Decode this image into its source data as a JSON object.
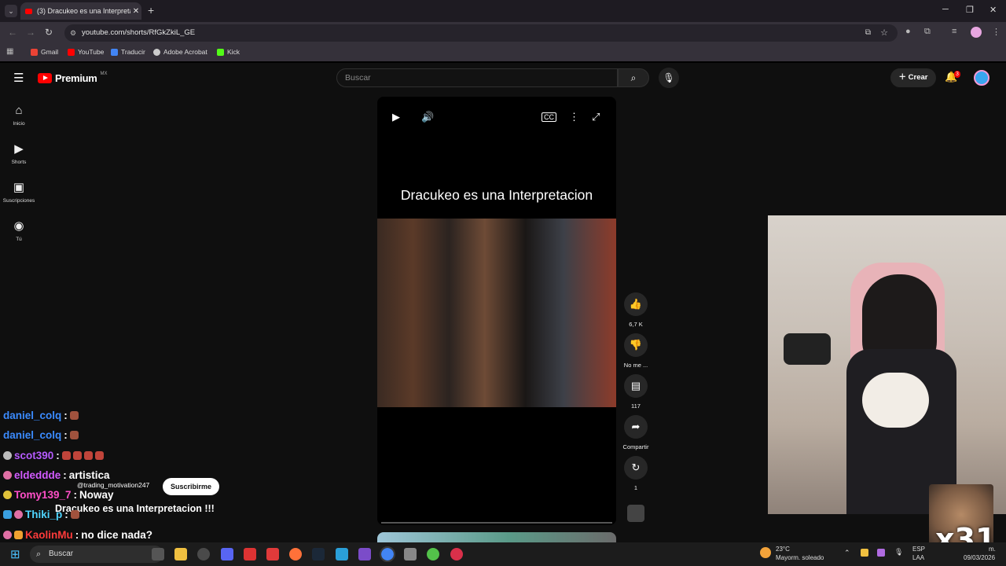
{
  "browser": {
    "tab_title": "(3) Dracukeo es una Interpretac",
    "url": "youtube.com/shorts/RfGkZkiL_GE",
    "bookmarks": [
      {
        "label": "Gmail",
        "color": "#ea4335"
      },
      {
        "label": "YouTube",
        "color": "#ff0000"
      },
      {
        "label": "Traducir",
        "color": "#4285f4"
      },
      {
        "label": "Adobe Acrobat",
        "color": "#cccccc"
      },
      {
        "label": "Kick",
        "color": "#53fc18"
      }
    ]
  },
  "youtube": {
    "logo_text": "Premium",
    "logo_region": "MX",
    "search_placeholder": "Buscar",
    "create_label": "Crear",
    "notification_count": "3",
    "sidebar": [
      {
        "label": "Inicio",
        "icon": "home-icon"
      },
      {
        "label": "Shorts",
        "icon": "shorts-icon"
      },
      {
        "label": "Suscripciones",
        "icon": "subscriptions-icon"
      },
      {
        "label": "Tú",
        "icon": "you-icon"
      }
    ],
    "short": {
      "title": "Dracukeo es una Interpretacion",
      "channel": "@trading_motivation247",
      "subscribe_label": "Suscribirme",
      "caption": "Dracukeo es una Interpretacion !!!"
    },
    "actions": {
      "likes": "6,7 K",
      "dislike": "No me ...",
      "comments": "117",
      "share": "Compartir",
      "remix": "1"
    }
  },
  "chat": [
    {
      "user": "daniel_colq",
      "message": "",
      "color": "#3b8bff"
    },
    {
      "user": "daniel_colq",
      "message": "",
      "color": "#3b8bff"
    },
    {
      "user": "scot390",
      "message": "",
      "color": "#b65bff"
    },
    {
      "user": "eldeddde",
      "message": "artistica",
      "color": "#d25bff"
    },
    {
      "user": "Tomy139_7",
      "message": "Noway",
      "color": "#ff4fc8"
    },
    {
      "user": "Thiki_p",
      "message": "",
      "color": "#4fd5ff"
    },
    {
      "user": "KaolinMu",
      "message": "no dice nada?",
      "color": "#ff3b3b"
    }
  ],
  "overlay": {
    "multiplier": "x31"
  },
  "taskbar": {
    "search_placeholder": "Buscar",
    "weather_temp": "23°C",
    "weather_desc": "Mayorm. soleado",
    "lang": "ESP",
    "lang_sub": "LAA",
    "time": "m.",
    "date": "09/03/2026"
  }
}
